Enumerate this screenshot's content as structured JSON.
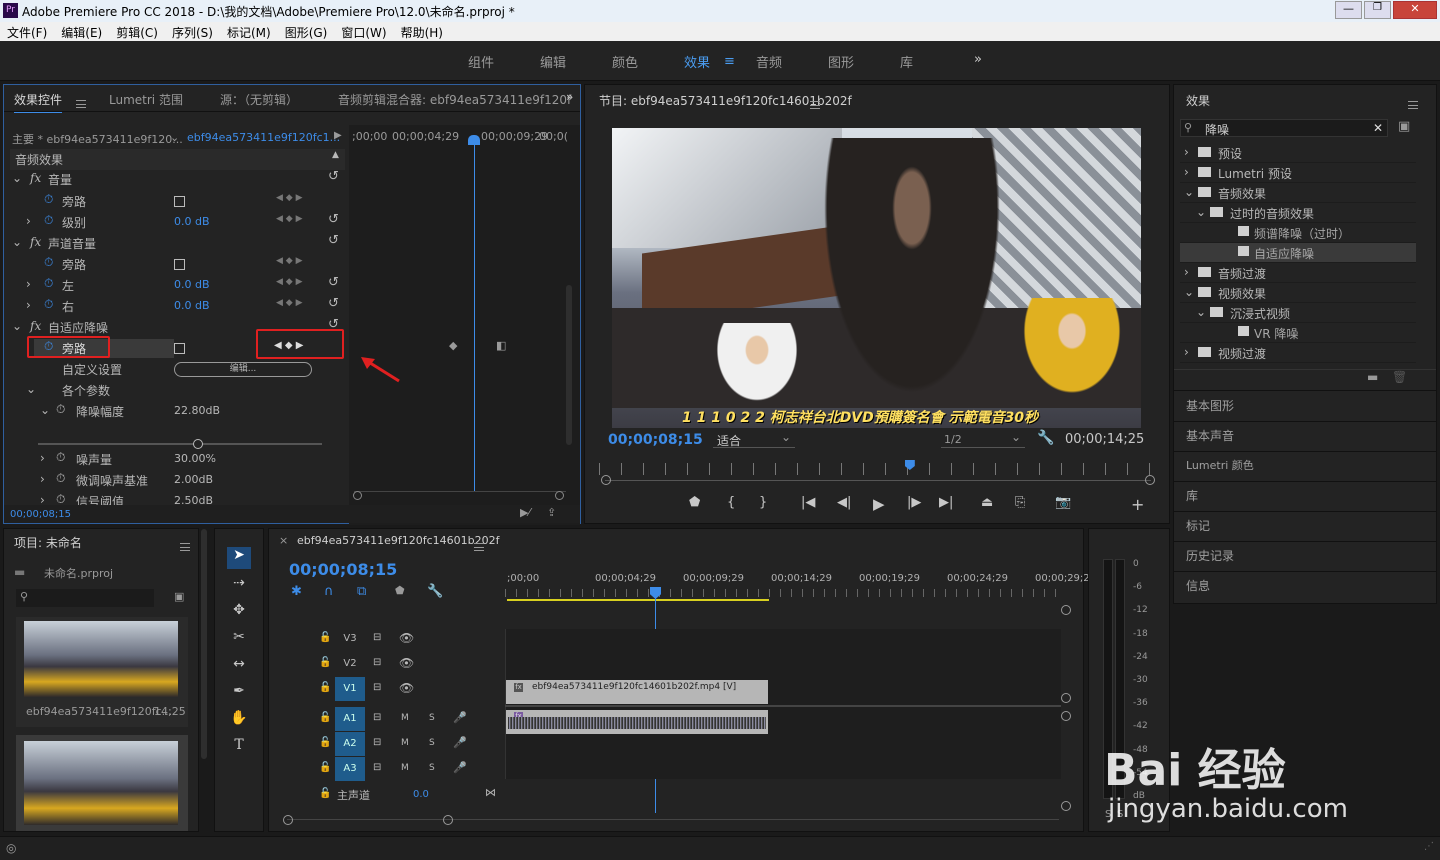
{
  "window": {
    "title": "Adobe Premiere Pro CC 2018 - D:\\我的文档\\Adobe\\Premiere Pro\\12.0\\未命名.prproj *",
    "app_icon": "Pr",
    "controls": [
      "minimize",
      "maximize",
      "close"
    ]
  },
  "menu": [
    "文件(F)",
    "编辑(E)",
    "剪辑(C)",
    "序列(S)",
    "标记(M)",
    "图形(G)",
    "窗口(W)",
    "帮助(H)"
  ],
  "workspaces": {
    "items": [
      "组件",
      "编辑",
      "颜色",
      "效果",
      "音频",
      "图形",
      "库"
    ],
    "active": "效果",
    "more": "»"
  },
  "effect_controls": {
    "tabs": [
      "效果控件",
      "Lumetri 范围",
      "源：（无剪辑）",
      "音频剪辑混合器: ebf94ea573411e9f120f"
    ],
    "master_label": "主要 * ebf94ea573411e9f120...",
    "clip_label": "ebf94ea573411e9f120fc1...",
    "timecodes": [
      ";00;00",
      "00;00;04;29",
      "00;00;09;29",
      "00;0("
    ],
    "section": "音频效果",
    "volume": {
      "name": "音量",
      "bypass": "旁路",
      "level_label": "级别",
      "level_value": "0.0 dB"
    },
    "channel_volume": {
      "name": "声道音量",
      "bypass": "旁路",
      "left_label": "左",
      "left_value": "0.0 dB",
      "right_label": "右",
      "right_value": "0.0 dB"
    },
    "denoise": {
      "name": "自适应降噪",
      "bypass": "旁路",
      "custom_label": "自定义设置",
      "edit_button": "编辑...",
      "params_label": "各个参数",
      "reduction_label": "降噪幅度",
      "reduction_value": "22.80dB",
      "noise_label": "噪声量",
      "noise_value": "30.00%",
      "tune_label": "微调噪声基准",
      "tune_value": "2.00dB",
      "signal_label": "信号阈值",
      "signal_value": "2.50dB"
    },
    "current_time": "00;00;08;15"
  },
  "program": {
    "title": "节目: ebf94ea573411e9f120fc14601b202f",
    "subtitle_text": "1 1 1 0 2 2  柯志祥台北DVD預購簽名會  示範電音30秒",
    "timecode": "00;00;08;15",
    "fit": "适合",
    "resolution": "1/2",
    "duration": "00;00;14;25",
    "playhead_fraction": 0.56
  },
  "effects_panel": {
    "title": "效果",
    "search_value": "降噪",
    "tree": [
      {
        "label": "预设",
        "level": 0,
        "icon": "star-folder",
        "expanded": false
      },
      {
        "label": "Lumetri 预设",
        "level": 0,
        "icon": "star-folder",
        "expanded": false
      },
      {
        "label": "音频效果",
        "level": 0,
        "icon": "folder",
        "expanded": true
      },
      {
        "label": "过时的音频效果",
        "level": 1,
        "icon": "folder",
        "expanded": true
      },
      {
        "label": "频谱降噪（过时）",
        "level": 2,
        "icon": "effect",
        "expanded": null
      },
      {
        "label": "自适应降噪",
        "level": 2,
        "icon": "effect",
        "expanded": null,
        "selected": true
      },
      {
        "label": "音频过渡",
        "level": 0,
        "icon": "folder",
        "expanded": false
      },
      {
        "label": "视频效果",
        "level": 0,
        "icon": "folder",
        "expanded": true
      },
      {
        "label": "沉浸式视频",
        "level": 1,
        "icon": "folder",
        "expanded": true
      },
      {
        "label": "VR 降噪",
        "level": 2,
        "icon": "effect",
        "expanded": null
      },
      {
        "label": "视频过渡",
        "level": 0,
        "icon": "folder",
        "expanded": false
      }
    ],
    "links": [
      "基本图形",
      "基本声音",
      "Lumetri 颜色",
      "库",
      "标记",
      "历史记录",
      "信息"
    ]
  },
  "project": {
    "title": "项目: 未命名",
    "file": "未命名.prproj",
    "clip_name": "ebf94ea573411e9f120fc...",
    "clip_duration": "14;25"
  },
  "timeline": {
    "title": "ebf94ea573411e9f120fc14601b202f",
    "timecode": "00;00;08;15",
    "ruler": [
      ";00;00",
      "00;00;04;29",
      "00;00;09;29",
      "00;00;14;29",
      "00;00;19;29",
      "00;00;24;29",
      "00;00;29;2"
    ],
    "video_tracks": [
      "V3",
      "V2",
      "V1"
    ],
    "audio_tracks": [
      "A1",
      "A2",
      "A3"
    ],
    "master_label": "主声道",
    "master_value": "0.0",
    "video_clip": "ebf94ea573411e9f120fc14601b202f.mp4 [V]",
    "m_label": "M",
    "s_label": "S"
  },
  "meter": {
    "scale": [
      "0",
      "-6",
      "-12",
      "-18",
      "-24",
      "-30",
      "-36",
      "-42",
      "-48",
      "-54",
      "dB"
    ],
    "channels": [
      "S",
      "S"
    ]
  },
  "watermark": {
    "brand": "Bai 经验",
    "url": "jingyan.baidu.com"
  },
  "colors": {
    "accent": "#3d8ce8",
    "highlight_red": "#e02020",
    "panel": "#232323"
  }
}
